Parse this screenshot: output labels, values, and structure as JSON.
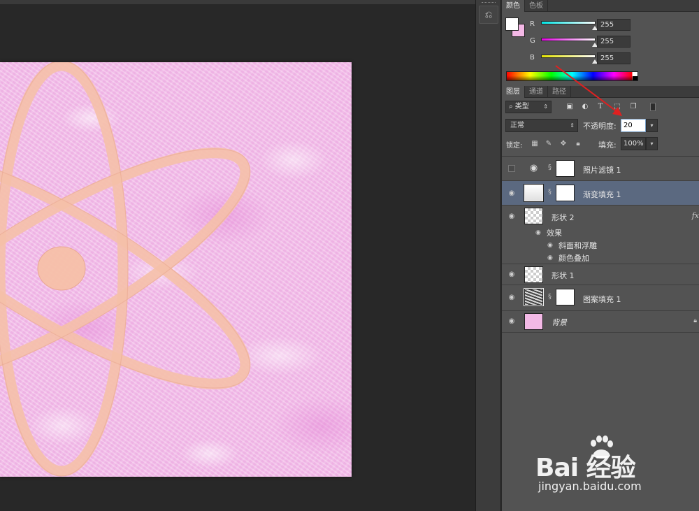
{
  "color_panel": {
    "tabs": [
      {
        "label": "颜色",
        "active": true
      },
      {
        "label": "色板",
        "active": false
      }
    ],
    "foreground_color": "#ffffff",
    "background_color": "#f4b8e6",
    "channels": [
      {
        "label": "R",
        "value": "255",
        "color": "#00e5e5"
      },
      {
        "label": "G",
        "value": "255",
        "color": "#e500e5"
      },
      {
        "label": "B",
        "value": "255",
        "color": "#e5e500"
      }
    ]
  },
  "layers_panel": {
    "tabs": [
      {
        "label": "图层",
        "active": true
      },
      {
        "label": "通道",
        "active": false
      },
      {
        "label": "路径",
        "active": false
      }
    ],
    "filter_kind": "类型",
    "blend_mode": "正常",
    "opacity_label": "不透明度:",
    "opacity_value": "20",
    "lock_label": "锁定:",
    "fill_label": "填充:",
    "fill_value": "100%",
    "layers": [
      {
        "name": "照片滤镜 1",
        "visible": false,
        "selected": false,
        "thumb": "adjust-icon",
        "mask": true
      },
      {
        "name": "渐变填充 1",
        "visible": true,
        "selected": true,
        "thumb": "gradient",
        "mask": true
      },
      {
        "name": "形状 2",
        "visible": true,
        "selected": false,
        "thumb": "checker",
        "mask": false,
        "fx": "fx",
        "effects_label": "效果",
        "effects": [
          "斜面和浮雕",
          "颜色叠加"
        ]
      },
      {
        "name": "形状 1",
        "visible": true,
        "selected": false,
        "thumb": "checker",
        "mask": false
      },
      {
        "name": "图案填充 1",
        "visible": true,
        "selected": false,
        "thumb": "pattern",
        "mask": true
      },
      {
        "name": "背景",
        "visible": true,
        "selected": false,
        "thumb": "pink",
        "mask": false,
        "locked": true
      }
    ]
  },
  "annotation": {
    "color": "#e02020"
  },
  "watermark": {
    "brand": "Bai 经验",
    "url": "jingyan.baidu.com"
  }
}
